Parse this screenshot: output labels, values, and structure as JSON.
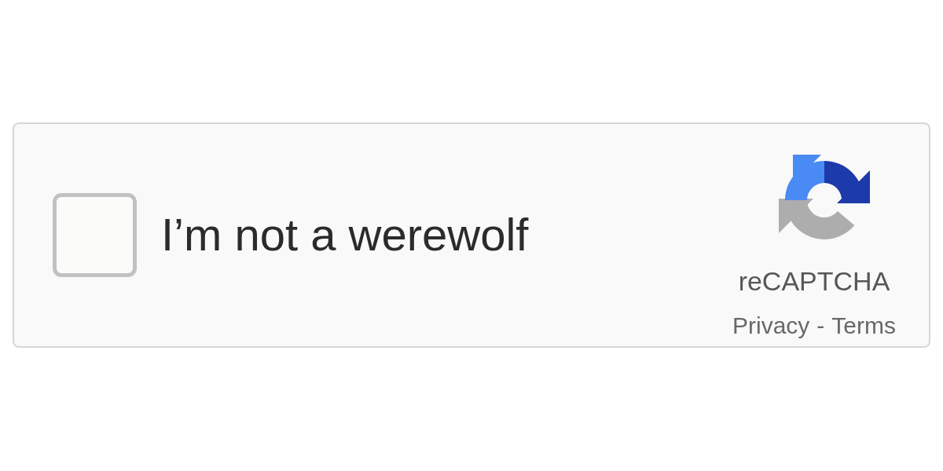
{
  "checkbox": {
    "label": "I’m not a werewolf",
    "checked": false
  },
  "branding": {
    "name": "reCAPTCHA",
    "links": [
      {
        "label": "Privacy"
      },
      {
        "label": "Terms"
      }
    ],
    "separator": "-"
  }
}
